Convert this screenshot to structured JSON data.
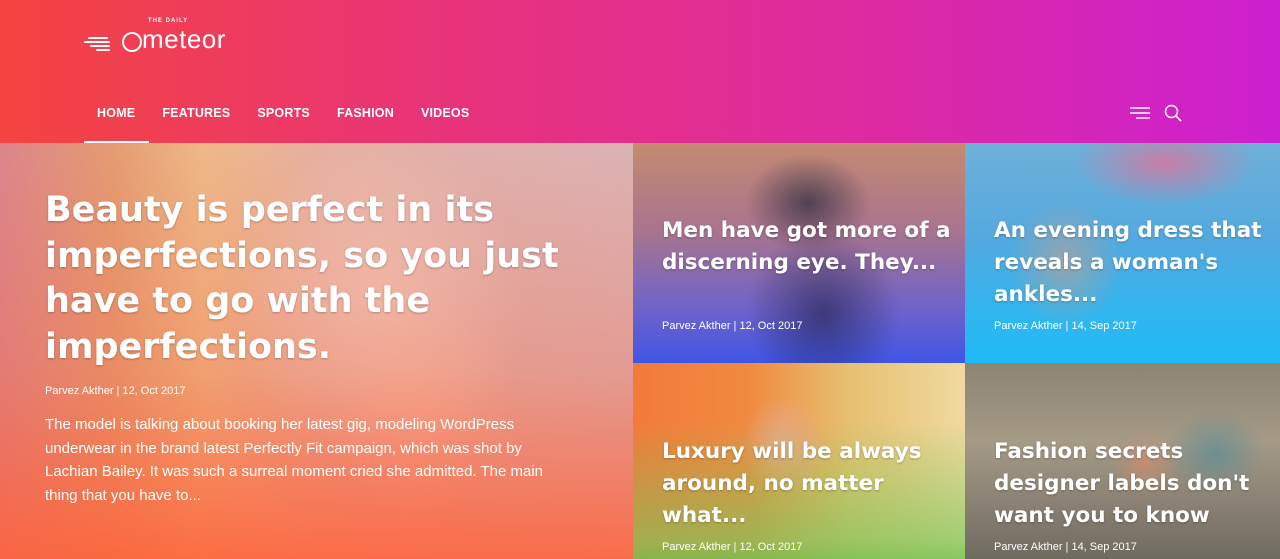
{
  "logo": {
    "small": "THE DAILY",
    "big": "meteor"
  },
  "nav": [
    {
      "label": "HOME"
    },
    {
      "label": "FEATURES"
    },
    {
      "label": "SPORTS"
    },
    {
      "label": "FASHION"
    },
    {
      "label": "VIDEOS"
    }
  ],
  "header_icons": [
    "menu-lines-icon",
    "search-icon"
  ],
  "colors": {
    "header_gradient": [
      "#f4443f",
      "#e8337a",
      "#dc2aa4",
      "#cc20d0"
    ],
    "text": "#ffffff"
  },
  "featured": {
    "title": "Beauty is perfect in its imperfections, so you just have to go with the imperfections.",
    "byline": "Parvez Akther | 12, Oct 2017",
    "excerpt": "The model is talking about booking her latest gig, modeling WordPress underwear in the brand latest Perfectly Fit campaign, which was shot by Lachian Bailey. It was such a surreal moment cried she admitted. The main thing that you have to..."
  },
  "articles": [
    {
      "title": "Men have got more of a discerning eye. They...",
      "byline": "Parvez Akther | 12, Oct 2017"
    },
    {
      "title": "An evening dress that reveals a woman's ankles...",
      "byline": "Parvez Akther | 14, Sep 2017"
    },
    {
      "title": "Luxury will be always around, no matter what...",
      "byline": "Parvez Akther | 12, Oct 2017"
    },
    {
      "title": "Fashion secrets designer labels don't want you to know",
      "byline": "Parvez Akther | 14, Sep 2017"
    }
  ]
}
